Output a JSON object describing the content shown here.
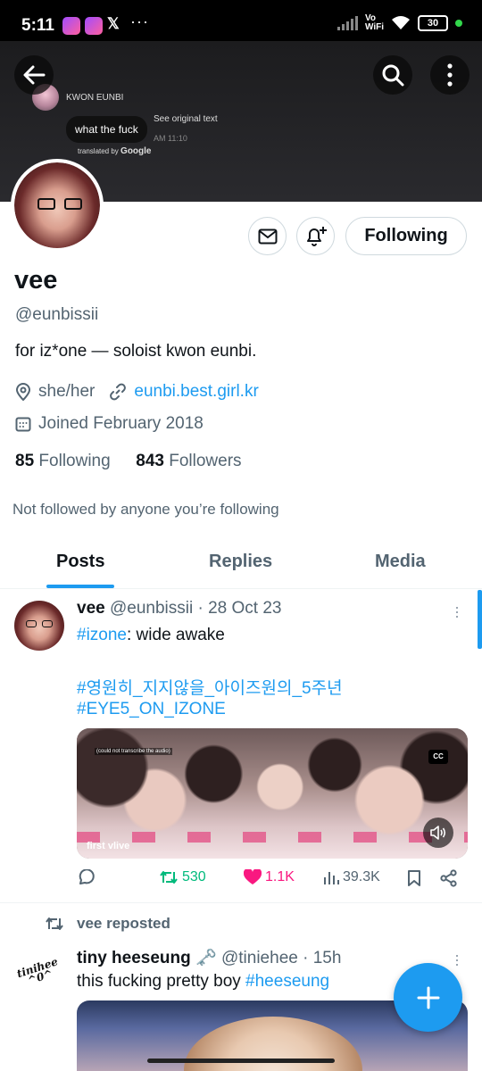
{
  "status_bar": {
    "time": "5:11",
    "app_icons": [
      "messenger-icon",
      "messenger-icon",
      "x-icon"
    ],
    "x_glyph": "𝕏",
    "overflow": "···",
    "vowifi": "Vo\nWiFi",
    "battery": "30"
  },
  "banner": {
    "name": "KWON EUNBI",
    "bubble_text": "what the fuck",
    "see_original": "See original text",
    "time": "AM 11:10",
    "translated_by": "translated by",
    "google": "Google"
  },
  "profile": {
    "name": "vee",
    "handle": "@eunbissii",
    "bio": "for iz*one — soloist kwon eunbi.",
    "pronouns": "she/her",
    "link": "eunbi.best.girl.kr",
    "joined": "Joined February 2018",
    "following_count": "85",
    "following_label": "Following",
    "followers_count": "843",
    "followers_label": "Followers",
    "not_followed": "Not followed by anyone you’re following",
    "following_button": "Following"
  },
  "tabs": [
    {
      "label": "Posts",
      "active": true
    },
    {
      "label": "Replies",
      "active": false
    },
    {
      "label": "Media",
      "active": false
    }
  ],
  "post1": {
    "name": "vee",
    "handle_date": "@eunbissii · 28 Oct 23",
    "hashtag1": "#izone",
    "text1": ": wide awake",
    "hashtag2": "#영원히_지지않을_아이즈원의_5주년",
    "hashtag3": "#EYE5_ON_IZONE",
    "media_caption": "(could not transcribe the audio)",
    "media_cc": "CC",
    "media_label": "first vlive",
    "retweets": "530",
    "likes": "1.1K",
    "views": "39.3K"
  },
  "post2": {
    "repost_label": "vee reposted",
    "avatar_text": "tinihee\n^0^",
    "name": "tiny heeseung",
    "key_emoji": "🗝️",
    "handle_time": "@tiniehee · 15h",
    "text": "this fucking pretty boy ",
    "hashtag": "#heeseung"
  },
  "colors": {
    "accent": "#1d9bf0",
    "retweet": "#00ba7c",
    "like": "#f91880",
    "secondary_text": "#536471"
  }
}
